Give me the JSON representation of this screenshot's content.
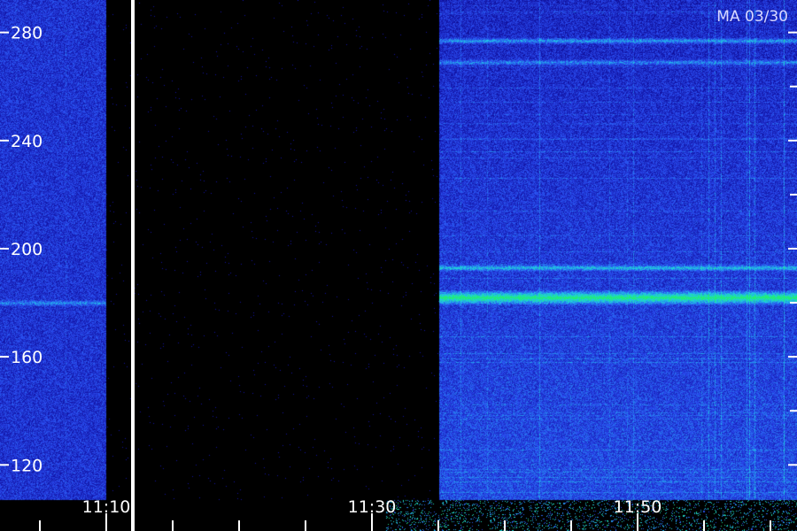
{
  "window": {
    "station_label": "MA 03/30"
  },
  "colors": {
    "background": "#000000",
    "noise_low": "#1010a0",
    "noise_mid": "#2a4cf0",
    "noise_high": "#20c8e8",
    "signal_peak": "#20f070",
    "marker": "#ffffff"
  },
  "chart_data": {
    "type": "heatmap",
    "title": "",
    "xlabel": "",
    "ylabel": "",
    "x_ticks": [
      {
        "value": "11:10",
        "label": "11:10"
      },
      {
        "value": "11:30",
        "label": "11:30"
      },
      {
        "value": "11:50",
        "label": "11:50"
      }
    ],
    "y_ticks": [
      120,
      160,
      200,
      240,
      280
    ],
    "ylim": [
      107,
      292
    ],
    "xlim": [
      "11:02",
      "11:62"
    ],
    "minor_x_tick_interval_min": 5,
    "gaps": [
      {
        "start": "11:10",
        "end": "11:35",
        "description": "no data"
      }
    ],
    "markers": [
      {
        "time": "11:12",
        "color": "#ffffff"
      }
    ],
    "bands": [
      {
        "y": 182,
        "intensity": 1.0,
        "from": "11:35",
        "to": "12:02"
      },
      {
        "y": 193,
        "intensity": 0.6,
        "from": "11:35",
        "to": "12:02"
      },
      {
        "y": 277,
        "intensity": 0.55,
        "from": "11:35",
        "to": "12:02"
      },
      {
        "y": 269,
        "intensity": 0.45,
        "from": "11:35",
        "to": "12:02"
      },
      {
        "y": 180,
        "intensity": 0.5,
        "from": "11:02",
        "to": "11:10"
      }
    ],
    "color_scale": [
      "#000000",
      "#1010a0",
      "#2a4cf0",
      "#20c8e8",
      "#20f070"
    ],
    "grid": false,
    "legend": "none"
  }
}
